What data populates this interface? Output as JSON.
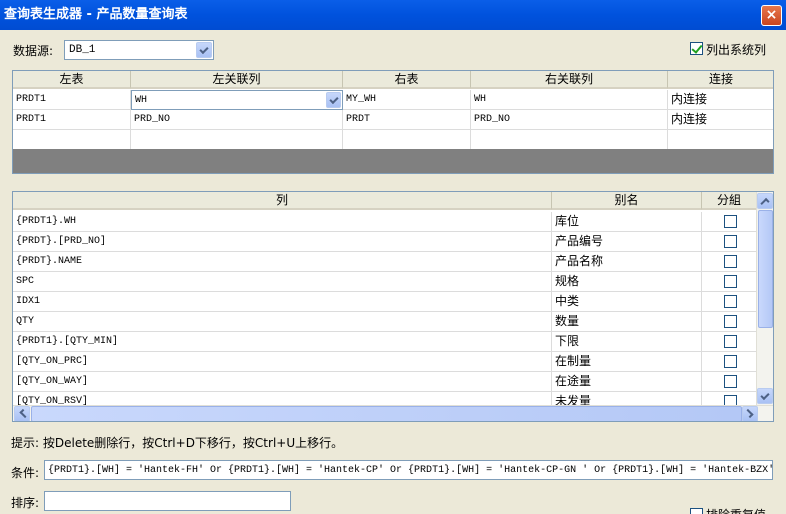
{
  "window": {
    "title": "查询表生成器 - 产品数量查询表",
    "close_glyph": "×"
  },
  "datasource": {
    "label": "数据源:",
    "value": "DB_1"
  },
  "list_system_cols": {
    "label": "列出系统列",
    "checked": true
  },
  "join_table": {
    "headers": [
      "左表",
      "左关联列",
      "右表",
      "右关联列",
      "连接"
    ],
    "rows": [
      [
        "PRDT1",
        "WH",
        "MY_WH",
        "WH",
        "内连接"
      ],
      [
        "PRDT1",
        "PRD_NO",
        "PRDT",
        "PRD_NO",
        "内连接"
      ]
    ]
  },
  "column_table": {
    "headers": [
      "列",
      "别名",
      "分組"
    ],
    "rows": [
      [
        "{PRDT1}.WH",
        "库位"
      ],
      [
        "{PRDT}.[PRD_NO]",
        "产品编号"
      ],
      [
        "{PRDT}.NAME",
        "产品名称"
      ],
      [
        "SPC",
        "规格"
      ],
      [
        "IDX1",
        "中类"
      ],
      [
        "QTY",
        "数量"
      ],
      [
        "{PRDT1}.[QTY_MIN]",
        "下限"
      ],
      [
        "[QTY_ON_PRC]",
        "在制量"
      ],
      [
        "[QTY_ON_WAY]",
        "在途量"
      ],
      [
        "[QTY_ON_RSV]",
        "未发量"
      ]
    ]
  },
  "hint": "提示: 按Delete删除行，按Ctrl+D下移行，按Ctrl+U上移行。",
  "condition": {
    "label": "条件:",
    "value": "{PRDT1}.[WH] = 'Hantek-FH' Or {PRDT1}.[WH] = 'Hantek-CP' Or {PRDT1}.[WH] = 'Hantek-CP-GN ' Or {PRDT1}.[WH] = 'Hantek-BZX'"
  },
  "sort": {
    "label": "排序:",
    "value": ""
  },
  "exclude_dup": {
    "label": "排除重复值"
  },
  "colors": {
    "titlebar": "#0a5ee8",
    "dialog_bg": "#ece9d8",
    "grid_dark": "#808080"
  }
}
